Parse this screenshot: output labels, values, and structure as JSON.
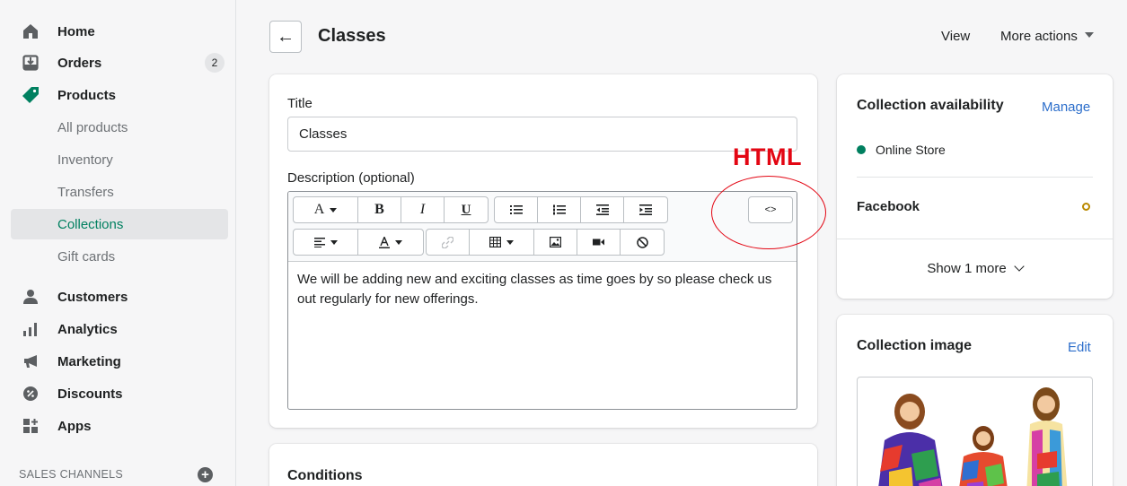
{
  "sidebar": {
    "items": [
      {
        "label": "Home",
        "icon": "home-icon"
      },
      {
        "label": "Orders",
        "icon": "orders-icon",
        "badge": "2"
      },
      {
        "label": "Products",
        "icon": "tag-icon"
      },
      {
        "label": "All products"
      },
      {
        "label": "Inventory"
      },
      {
        "label": "Transfers"
      },
      {
        "label": "Collections"
      },
      {
        "label": "Gift cards"
      },
      {
        "label": "Customers",
        "icon": "person-icon"
      },
      {
        "label": "Analytics",
        "icon": "bar-chart-icon"
      },
      {
        "label": "Marketing",
        "icon": "megaphone-icon"
      },
      {
        "label": "Discounts",
        "icon": "discount-icon"
      },
      {
        "label": "Apps",
        "icon": "apps-icon"
      }
    ],
    "sales_channels": "SALES CHANNELS"
  },
  "header": {
    "title": "Classes",
    "view": "View",
    "more_actions": "More actions"
  },
  "main": {
    "title_label": "Title",
    "title_value": "Classes",
    "description_label": "Description (optional)",
    "description_text": "We will be adding new and exciting classes as time goes by so please check us out regularly for new offerings.",
    "toolbar": {
      "font": "A",
      "bold": "B",
      "italic": "I",
      "underline": "U",
      "html": "<>"
    },
    "annotation": "HTML",
    "conditions_title": "Conditions"
  },
  "availability": {
    "title": "Collection availability",
    "manage": "Manage",
    "online_store": "Online Store",
    "facebook": "Facebook",
    "show_more": "Show 1 more",
    "colors": {
      "online": "#007f5f",
      "facebook": "#b98900"
    }
  },
  "collection_image": {
    "title": "Collection image",
    "edit": "Edit"
  }
}
